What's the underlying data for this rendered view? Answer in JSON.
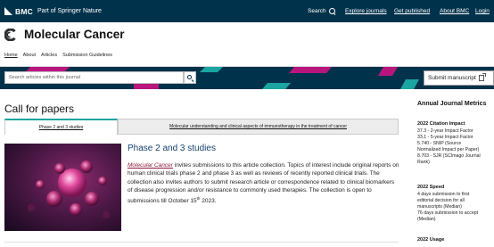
{
  "topbar": {
    "brand_name": "BMC",
    "brand_sub": "Part of Springer Nature",
    "search_label": "Search",
    "links": [
      "Explore journals",
      "Get published",
      "About BMC",
      "Login"
    ]
  },
  "journal": {
    "title": "Molecular Cancer"
  },
  "subnav": {
    "items": [
      "Home",
      "About",
      "Articles",
      "Submission Guidelines"
    ]
  },
  "search": {
    "placeholder": "Search articles within this journal"
  },
  "submit": {
    "label": "Submit manuscript"
  },
  "main": {
    "heading": "Call for papers",
    "tabs": [
      {
        "label": "Phase 2 and 3 studies",
        "active": true
      },
      {
        "label": "Molecular understanding and clinical aspects of immunotherapy in the treatment of cancer",
        "active": false
      }
    ],
    "article": {
      "title": "Phase 2 and 3 studies",
      "journal_link": "Molecular Cancer",
      "body_part1": " invites submissions to this article collection. Topics of interest include original reports on human clinical trials phase 2 and phase 3 as well as reviews of recently reported clinical trials. The collection also invites authors to submit research article or correspondence related to clinical biomarkers of disease progression and/or resistance to commonly used therapies. The collection is open to submissions till October 15",
      "body_sup": "th",
      "body_part2": " 2023."
    }
  },
  "sidebar": {
    "title": "Annual Journal Metrics",
    "sections": [
      {
        "heading": "2022 Citation Impact",
        "lines": [
          "37.3 - 2-year Impact Factor",
          "33.1 - 5-year Impact Factor",
          "5.740 - SNIP (Source",
          "Normalized Impact per Paper)",
          "8.703 - SJR (SCImago Journal",
          "Rank)"
        ]
      },
      {
        "heading": "2022 Speed",
        "lines": [
          "4 days submission to first",
          "editorial decision for all",
          "manuscripts (Median)",
          "76 days submission to accept",
          "(Median)"
        ]
      },
      {
        "heading": "2022 Usage",
        "lines": []
      }
    ]
  },
  "colors": {
    "topbar_bg": "#01324b",
    "accent_magenta": "#b8167e",
    "accent_teal": "#1aa5a2",
    "title_blue": "#15426f",
    "link_crimson": "#8a1a3a"
  },
  "icons": [
    "search-icon",
    "molecular-cancer-logo",
    "magnifier-icon",
    "external-link-icon"
  ]
}
